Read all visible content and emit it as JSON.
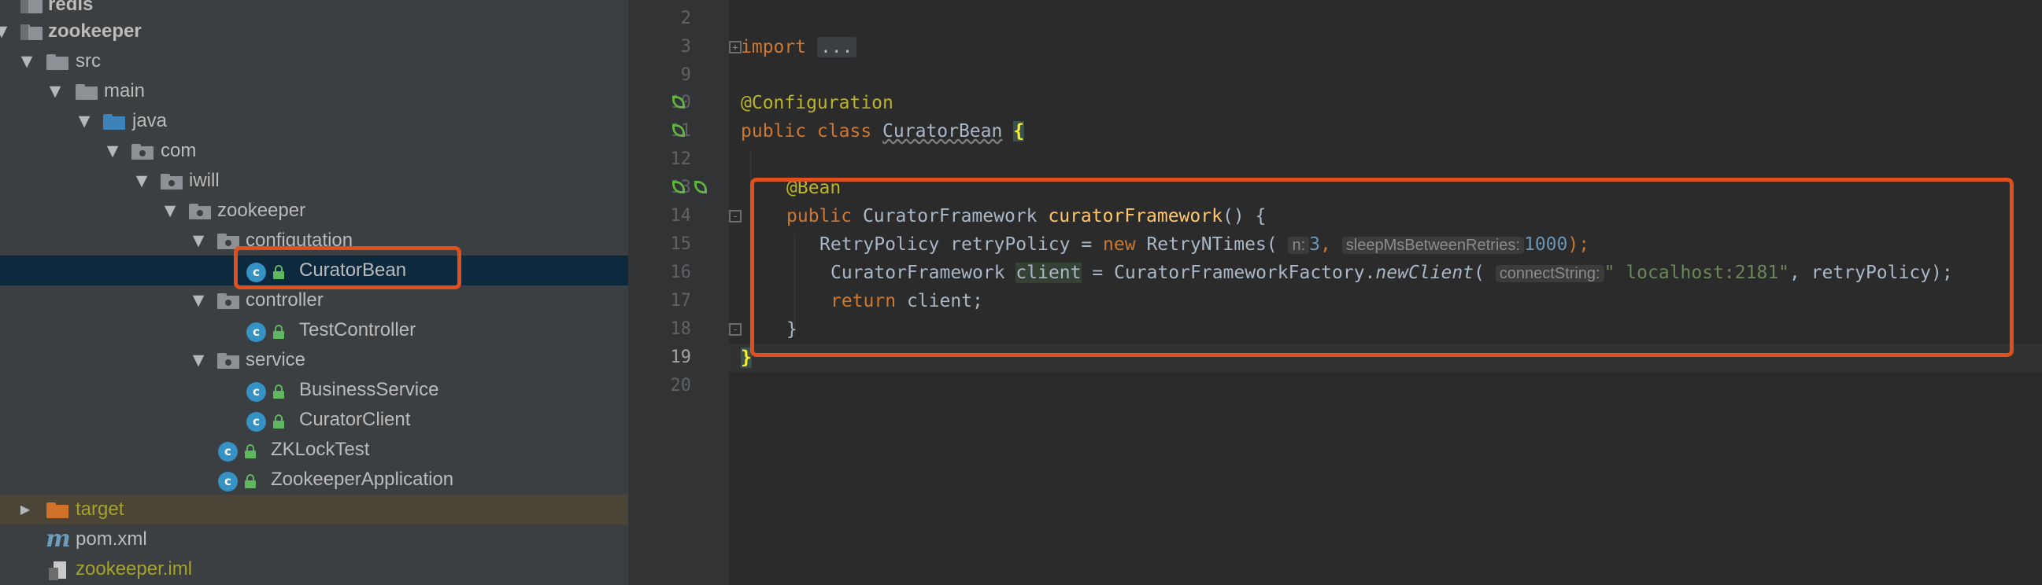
{
  "colors": {
    "tree_bg": "#3c3f41",
    "editor_bg": "#2b2b2b",
    "gutter_bg": "#313335",
    "selection": "#0d293e",
    "highlight_box": "#e0501d",
    "keyword": "#cc7832",
    "annotation": "#bbb529",
    "number": "#6897bb",
    "string": "#6a8759",
    "method": "#ffc66d"
  },
  "tree": {
    "items": [
      {
        "label": "redis",
        "icon": "module-folder-icon"
      },
      {
        "label": "zookeeper",
        "icon": "module-folder-icon"
      },
      {
        "label": "src",
        "icon": "folder-icon"
      },
      {
        "label": "main",
        "icon": "folder-icon"
      },
      {
        "label": "java",
        "icon": "source-folder-icon"
      },
      {
        "label": "com",
        "icon": "package-icon"
      },
      {
        "label": "iwill",
        "icon": "package-icon"
      },
      {
        "label": "zookeeper",
        "icon": "package-icon"
      },
      {
        "label": "configutation",
        "icon": "package-icon"
      },
      {
        "label": "CuratorBean",
        "icon": "class-icon"
      },
      {
        "label": "controller",
        "icon": "package-icon"
      },
      {
        "label": "TestController",
        "icon": "class-icon"
      },
      {
        "label": "service",
        "icon": "package-icon"
      },
      {
        "label": "BusinessService",
        "icon": "class-icon"
      },
      {
        "label": "CuratorClient",
        "icon": "class-icon"
      },
      {
        "label": "ZKLockTest",
        "icon": "runnable-class-icon"
      },
      {
        "label": "ZookeeperApplication",
        "icon": "spring-boot-class-icon"
      },
      {
        "label": "target",
        "icon": "excluded-folder-icon"
      },
      {
        "label": "pom.xml",
        "icon": "maven-icon"
      },
      {
        "label": "zookeeper.iml",
        "icon": "iml-file-icon"
      }
    ]
  },
  "editor": {
    "line_numbers": [
      "2",
      "3",
      "9",
      "10",
      "11",
      "12",
      "13",
      "14",
      "15",
      "16",
      "17",
      "18",
      "19",
      "20"
    ],
    "code": {
      "import_kw": "import",
      "import_fold": "...",
      "annotation_configuration": "@Configuration",
      "public_class": "public class",
      "class_name": "CuratorBean",
      "open_brace": "{",
      "annotation_bean": "@Bean",
      "public_kw": "public",
      "return_type": "CuratorFramework",
      "method_name": "curatorFramework",
      "method_sig_rest": "() {",
      "retry_type": "RetryPolicy retryPolicy =",
      "new_kw": "new",
      "retry_ctor": "RetryNTimes(",
      "hint_n": "n:",
      "num_3": "3",
      "comma": ",",
      "hint_sleep": "sleepMsBetweenRetries:",
      "num_1000": "1000",
      "close_stmt": ");",
      "cf_type": "CuratorFramework",
      "var_client": "client",
      "assign_factory": "= CuratorFrameworkFactory.",
      "new_client": "newClient",
      "paren_open": "(",
      "hint_conn": "connectString:",
      "conn_str": "\" localhost:2181\"",
      "args_tail": ", retryPolicy);",
      "return_kw": "return",
      "return_rest": "client;",
      "method_close": "}",
      "class_close": "}"
    }
  }
}
